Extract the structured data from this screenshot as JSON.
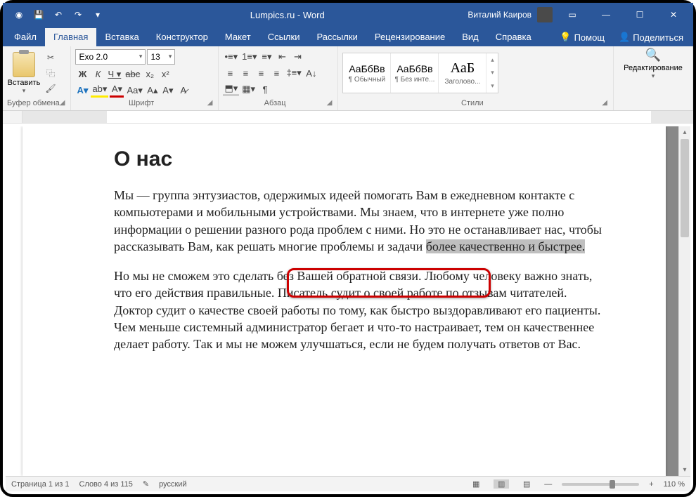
{
  "titlebar": {
    "title": "Lumpics.ru - Word",
    "user": "Виталий Каиров"
  },
  "tabs": {
    "file": "Файл",
    "home": "Главная",
    "insert": "Вставка",
    "design": "Конструктор",
    "layout": "Макет",
    "references": "Ссылки",
    "mailings": "Рассылки",
    "review": "Рецензирование",
    "view": "Вид",
    "help": "Справка",
    "tellme": "Помощ",
    "share": "Поделиться"
  },
  "ribbon": {
    "clipboard": {
      "label": "Буфер обмена",
      "paste": "Вставить"
    },
    "font": {
      "label": "Шрифт",
      "name": "Exo 2.0",
      "size": "13"
    },
    "paragraph": {
      "label": "Абзац"
    },
    "styles": {
      "label": "Стили",
      "items": [
        {
          "sample": "АаБбВв",
          "name": "¶ Обычный"
        },
        {
          "sample": "АаБбВв",
          "name": "¶ Без инте..."
        },
        {
          "sample": "АаБ",
          "name": "Заголово..."
        }
      ]
    },
    "editing": {
      "label": "Редактирование"
    }
  },
  "document": {
    "heading": "О нас",
    "p1_before": "Мы — группа энтузиастов, одержимых идеей помогать Вам в ежедневном контакте с компьютерами и мобильными устройствами. Мы знаем, что в интернете уже полно информации о решении разного рода проблем с ними. Но это не останавливает нас, чтобы рассказывать Вам, как решать многие проблемы и задачи ",
    "p1_selected": "более качественно и быстрее.",
    "p2": "Но мы не сможем это сделать без Вашей обратной связи. Любому человеку важно знать, что его действия правильные. Писатель судит о своей работе по отзывам читателей. Доктор судит о качестве своей работы по тому, как быстро выздоравливают его пациенты. Чем меньше системный администратор бегает и что-то настраивает, тем он качественнее делает работу. Так и мы не можем улучшаться, если не будем получать ответов от Вас."
  },
  "statusbar": {
    "page": "Страница 1 из 1",
    "words": "Слово 4 из 115",
    "lang": "русский",
    "zoom": "110 %"
  }
}
